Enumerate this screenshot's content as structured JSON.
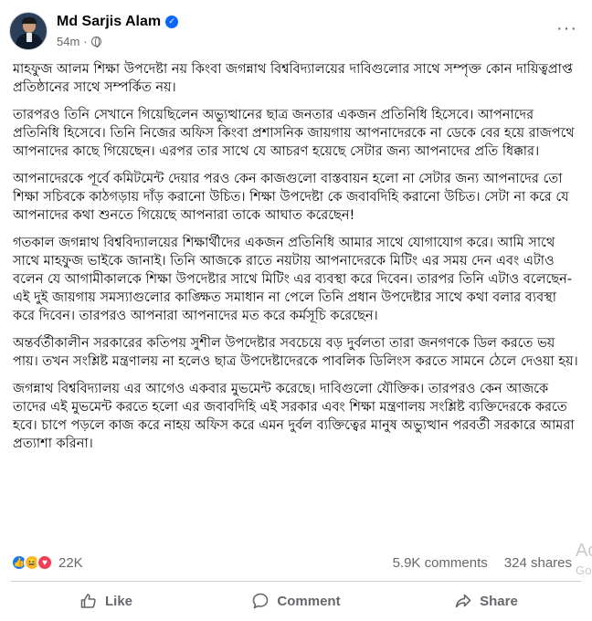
{
  "post": {
    "author": "Md Sarjis Alam",
    "verified_icon": "verified-badge-icon",
    "time": "54m",
    "audience_icon": "globe-icon",
    "more_label": "···",
    "paragraphs": [
      "মাহফুজ আলম শিক্ষা উপদেষ্টা নয় কিংবা জগন্নাথ বিশ্ববিদ্যালয়ের দাবিগুলোর সাথে সম্পৃক্ত কোন দায়িত্বপ্রাপ্ত প্রতিষ্ঠানের সাথে সম্পর্কিত নয়।",
      "তারপরও তিনি সেখানে গিয়েছিলেন অভ্যুত্থানের ছাত্র জনতার একজন প্রতিনিধি হিসেবে। আপনাদের প্রতিনিধি হিসেবে। তিনি নিজের অফিস কিংবা প্রশাসনিক জায়গায় আপনাদেরকে না ডেকে বের হয়ে রাজপথে আপনাদের কাছে গিয়েছেন। এরপর তার সাথে যে আচরণ হয়েছে সেটার জন্য আপনাদের প্রতি ধিক্কার।",
      "আপনাদেরকে পূর্বে কমিটমেন্ট দেয়ার পরও কেন কাজগুলো বাস্তবায়ন হলো না সেটার জন্য আপনাদের তো শিক্ষা সচিবকে কাঠগড়ায় দাঁড় করানো উচিত। শিক্ষা উপদেষ্টা কে জবাবদিহি করানো উচিত। সেটা না করে যে আপনাদের কথা শুনতে গিয়েছে আপনারা তাকে আঘাত করেছেন!",
      "গতকাল জগন্নাথ বিশ্ববিদ্যালয়ের শিক্ষার্থীদের একজন প্রতিনিধি আমার সাথে যোগাযোগ করে। আমি সাথে সাথে মাহফুজ ভাইকে জানাই। তিনি আজকে রাতে নয়টায় আপনাদেরকে মিটিং এর সময় দেন এবং এটাও বলেন যে আগামীকালকে শিক্ষা উপদেষ্টার সাথে মিটিং এর ব্যবস্থা করে দিবেন। তারপর তিনি এটাও বলেছেন- এই দুই জায়গায় সমস্যাগুলোর কাঙ্ক্ষিত সমাধান না পেলে তিনি প্রধান উপদেষ্টার সাথে কথা বলার ব্যবস্থা করে দিবেন। তারপরও আপনারা আপনাদের মত করে কর্মসূচি করেছেন।",
      "অন্তর্বর্তীকালীন সরকারের কতিপয় সুশীল উপদেষ্টার সবচেয়ে বড় দুর্বলতা তারা জনগণকে ডিল করতে ভয় পায়। তখন সংশ্লিষ্ট মন্ত্রণালয় না হলেও ছাত্র উপদেষ্টাদেরকে পাবলিক ডিলিংস করতে সামনে ঠেলে দেওয়া হয়।",
      "জগন্নাথ বিশ্ববিদ্যালয় এর আগেও একবার মুভমেন্ট করেছে। দাবিগুলো যৌক্তিক। তারপরও কেন আজকে তাদের এই মুভমেন্ট করতে হলো এর জবাবদিহি এই সরকার এবং শিক্ষা মন্ত্রণালয় সংশ্লিষ্ট ব্যক্তিদেরকে করতে হবে। চাপে পড়লে কাজ করে নাহয় অফিস করে এমন দুর্বল ব্যক্তিত্বের মানুষ অভ্যুত্থান পরবর্তী সরকারে আমরা প্রত্যাশা করিনা।"
    ]
  },
  "stats": {
    "reactions": [
      "like-reaction-icon",
      "haha-reaction-icon",
      "love-reaction-icon"
    ],
    "reaction_count": "22K",
    "comments": "5.9K comments",
    "shares": "324 shares"
  },
  "actions": {
    "like": "Like",
    "comment": "Comment",
    "share": "Share"
  },
  "watermark": {
    "line1": "Ac",
    "line2": "Go"
  },
  "colors": {
    "secondary_text": "#65676b",
    "verified_blue": "#0866ff",
    "like_blue": "#1877f2",
    "love_red": "#f33e58",
    "haha_yellow": "#f7b928"
  }
}
